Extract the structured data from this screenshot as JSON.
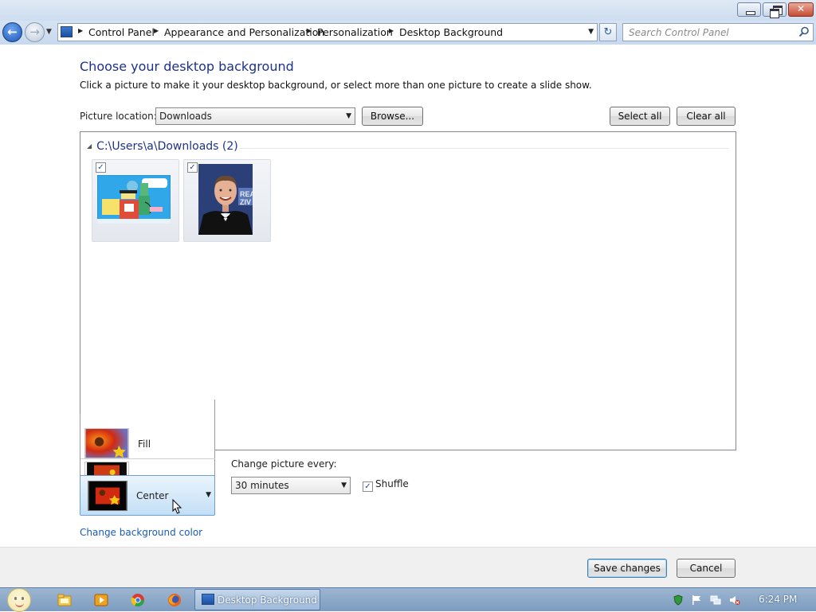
{
  "window": {
    "breadcrumbs": [
      "Control Panel",
      "Appearance and Personalization",
      "Personalization",
      "Desktop Background"
    ],
    "search_placeholder": "Search Control Panel"
  },
  "main": {
    "title": "Choose your desktop background",
    "description": "Click a picture to make it your desktop background, or select more than one picture to create a slide show.",
    "picture_location_label": "Picture location:",
    "picture_location_value": "Downloads",
    "browse_label": "Browse...",
    "select_all_label": "Select all",
    "clear_all_label": "Clear all",
    "group_header": "C:\\Users\\a\\Downloads (2)",
    "pictures": [
      {
        "checked": true,
        "icon": "cartoon-thumbnail"
      },
      {
        "checked": true,
        "icon": "portrait-thumbnail"
      }
    ]
  },
  "position": {
    "popup_option": "Fill",
    "selected": "Center"
  },
  "slideshow": {
    "interval_label": "Change picture every:",
    "interval_value": "30 minutes",
    "shuffle_label": "Shuffle",
    "shuffle_checked": true
  },
  "links": {
    "change_background_color": "Change background color"
  },
  "footer": {
    "save_label": "Save changes",
    "cancel_label": "Cancel"
  },
  "taskbar": {
    "active_task": "Desktop Background",
    "clock": "6:24 PM",
    "pinned": [
      "explorer-icon",
      "media-player-icon",
      "chrome-icon",
      "firefox-icon"
    ]
  },
  "colors": {
    "title_blue": "#1e3287",
    "link_blue": "#1a5bb8",
    "taskbar": "#8aa7c8"
  }
}
